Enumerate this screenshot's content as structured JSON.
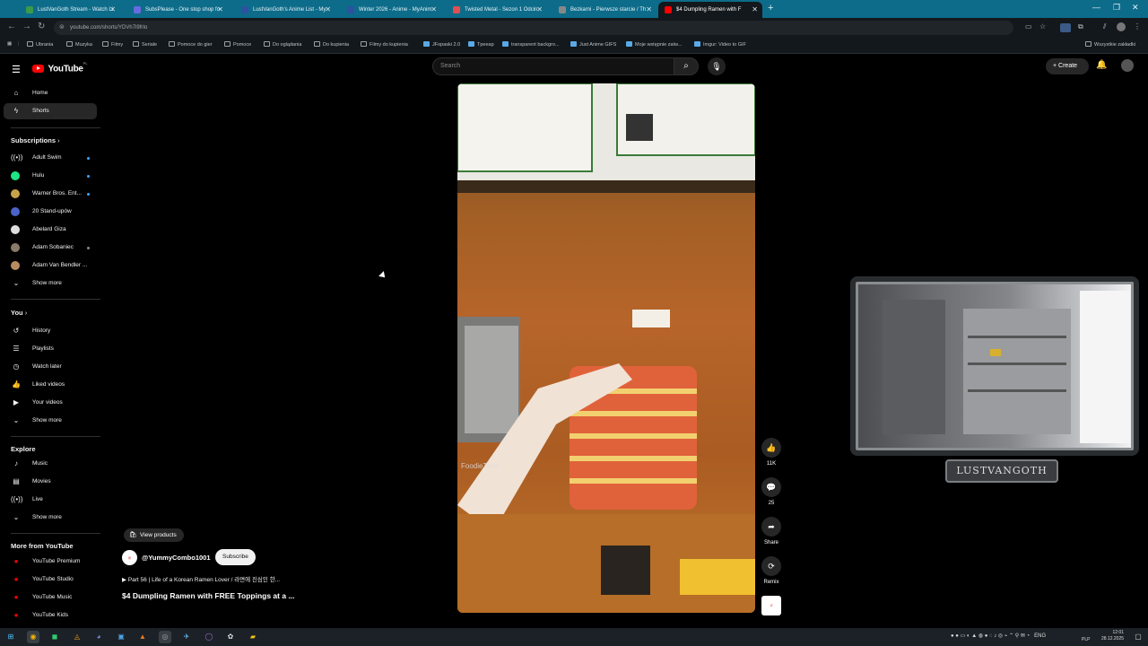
{
  "browser": {
    "tabs": [
      {
        "title": "LustVanGoth Stream - Watch Li",
        "fav": "#3a9a4a"
      },
      {
        "title": "SubsPlease - One stop shop fo",
        "fav": "#6a6ae0"
      },
      {
        "title": "LustVanGoth's Anime List - My",
        "fav": "#2e51a2"
      },
      {
        "title": "Winter 2026 - Anime - MyAnim",
        "fav": "#2e51a2"
      },
      {
        "title": "Twisted Metal - Sezon 1 Odcin",
        "fav": "#e05050"
      },
      {
        "title": "Bezkarni - Pierwsze starcie / Th",
        "fav": "#888888"
      },
      {
        "title": "$4 Dumpling Ramen with F",
        "fav": "#ff0000"
      }
    ],
    "url": "youtube.com/shorts/YDVh7i9frIo",
    "bookmarks": [
      "Ubrania",
      "Muzyka",
      "Filmy",
      "Seriale",
      "Pomoce do gier",
      "Pomoce",
      "Do oglądania",
      "Do kupienia",
      "Filmy do kupienia",
      "JFopaski 2.0",
      "Tpeeap",
      "transparent backgro...",
      "Just Anime GIFS",
      "Moje wstępnie zatw...",
      "Imgur: Video to GIF"
    ],
    "all_bookmarks": "Wszystkie zakładki"
  },
  "youtube": {
    "logo": "YouTube",
    "logo_country": "PL",
    "search_placeholder": "Search",
    "create": "Create",
    "nav": {
      "home": "Home",
      "shorts": "Shorts"
    },
    "subscriptions_header": "Subscriptions",
    "subscriptions": [
      "Adult Swim",
      "Hulu",
      "Warner Bros. Ent...",
      "20 Stand-upów",
      "Abelard Giza",
      "Adam Sobaniec",
      "Adam Van Bendler ..."
    ],
    "show_more": "Show more",
    "you_header": "You",
    "you_items": [
      "History",
      "Playlists",
      "Watch later",
      "Liked videos",
      "Your videos"
    ],
    "explore_header": "Explore",
    "explore_items": [
      "Music",
      "Movies",
      "Live"
    ],
    "more_header": "More from YouTube",
    "more_items": [
      "YouTube Premium",
      "YouTube Studio",
      "YouTube Music",
      "YouTube Kids"
    ]
  },
  "short": {
    "watermark": "FoodieTime",
    "likes": "11K",
    "comments": "25",
    "share": "Share",
    "remix": "Remix",
    "view_products": "View products",
    "channel": "@YummyCombo1001",
    "subscribe": "Subscribe",
    "playlist": "Part 56 | Life of a Korean Ramen Lover / 라면에 진심인 한...",
    "title": "$4 Dumpling Ramen with FREE Toppings at a ..."
  },
  "overlay": {
    "label": "LUSTVANGOTH"
  },
  "taskbar": {
    "lang": "ENG",
    "lang2": "PLP",
    "time": "12:01",
    "date": "28.12.2025"
  }
}
